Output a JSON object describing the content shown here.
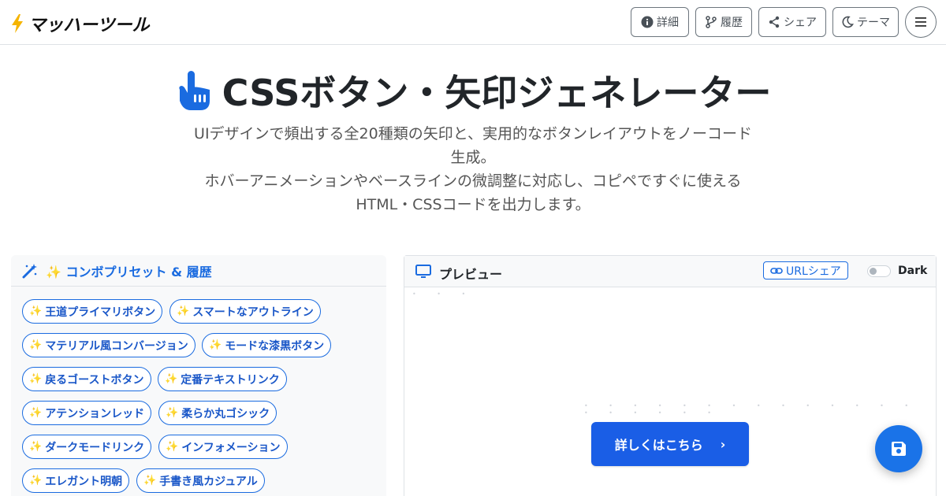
{
  "header": {
    "logo_text": "マッハーツール",
    "buttons": {
      "details": "詳細",
      "history": "履歴",
      "share": "シェア",
      "theme": "テーマ"
    }
  },
  "hero": {
    "title": "CSSボタン・矢印ジェネレーター",
    "description_lines": [
      "UIデザインで頻出する全20種類の矢印と、実用的なボタンレイアウトをノーコード",
      "生成。",
      "ホバーアニメーションやベースラインの微調整に対応し、コピペですぐに使える",
      "HTML・CSSコードを出力します。"
    ]
  },
  "presets": {
    "title": "✨ コンボプリセット & 履歴",
    "items": [
      "王道プライマリボタン",
      "スマートなアウトライン",
      "マテリアル風コンバージョン",
      "モードな漆黒ボタン",
      "戻るゴーストボタン",
      "定番テキストリンク",
      "アテンションレッド",
      "柔らか丸ゴシック",
      "ダークモードリンク",
      "インフォメーション",
      "エレガント明朝",
      "手書き風カジュアル"
    ],
    "sparkle": "✨"
  },
  "preview": {
    "title": "プレビュー",
    "url_share": "URLシェア",
    "dark_label": "Dark",
    "dark_enabled": false,
    "button_label": "詳しくはこちら",
    "button_arrow": "›"
  },
  "colors": {
    "accent": "#1a6be0",
    "preview_button": "#1a5ee6",
    "fab": "#1a73e8",
    "bolt": "#f5b400"
  },
  "icons": {
    "logo": "lightning-bolt-icon",
    "details": "info-circle-icon",
    "history": "branch-icon",
    "share": "share-nodes-icon",
    "theme": "moon-icon",
    "menu": "hamburger-icon",
    "hero": "pointing-hand-icon",
    "presets": "magic-wand-icon",
    "preview": "monitor-icon",
    "url_share": "link-icon",
    "fab": "floppy-disk-icon"
  }
}
